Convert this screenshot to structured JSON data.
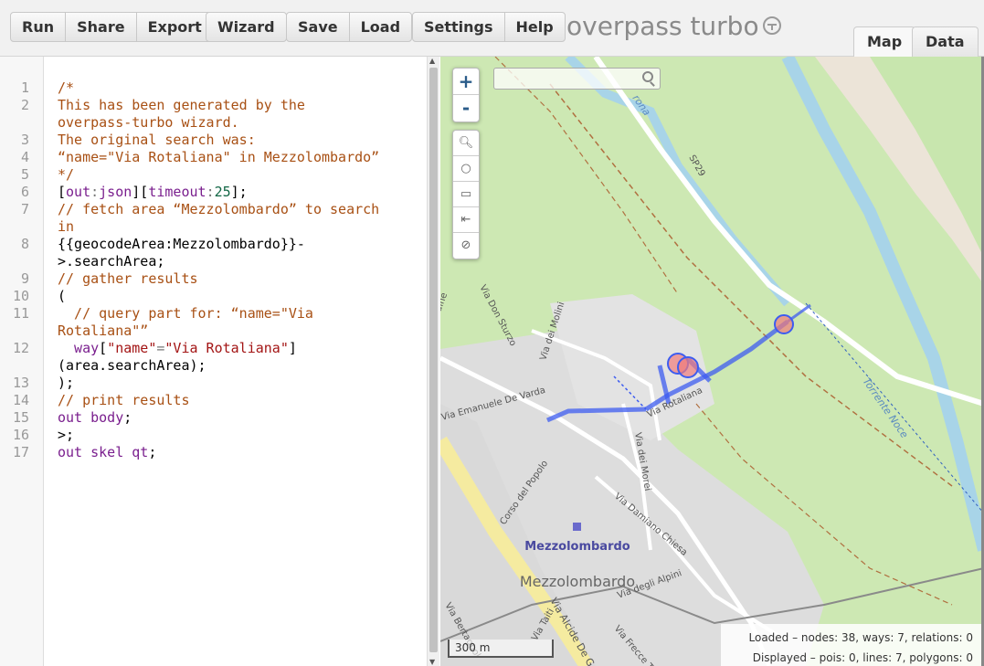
{
  "toolbar": {
    "group1": [
      "Run",
      "Share",
      "Export"
    ],
    "group2": [
      "Wizard"
    ],
    "group3": [
      "Save",
      "Load"
    ],
    "group4": [
      "Settings",
      "Help"
    ],
    "logo": "overpass turbo"
  },
  "tabs": {
    "map": "Map",
    "data": "Data"
  },
  "editor": {
    "line_numbers": [
      "1",
      "2",
      "",
      "3",
      "4",
      "5",
      "6",
      "7",
      "",
      "8",
      "",
      "9",
      "10",
      "11",
      "",
      "12",
      "",
      "13",
      "14",
      "15",
      "16",
      "17"
    ],
    "lines": {
      "l1": "/*",
      "l2a": "This has been generated by the",
      "l2b": "overpass-turbo wizard.",
      "l3": "The original search was:",
      "l4": "“name=\"Via Rotaliana\" in Mezzolombardo”",
      "l5": "*/",
      "l6_a": "[",
      "l6_b": "out",
      "l6_c": ":",
      "l6_d": "json",
      "l6_e": "][",
      "l6_f": "timeout",
      "l6_g": ":",
      "l6_h": "25",
      "l6_i": "];",
      "l7a": "// fetch area “Mezzolombardo” to search",
      "l7b": "in",
      "l8a": "{{geocodeArea:Mezzolombardo}}-",
      "l8b": ">.searchArea;",
      "l9": "// gather results",
      "l10": "(",
      "l11a": "  // query part for: “name=\"Via",
      "l11b": "Rotaliana\"”",
      "l12_kw": "  way",
      "l12_a": "[",
      "l12_str1": "\"name\"",
      "l12_eq": "=",
      "l12_str2": "\"Via Rotaliana\"",
      "l12_b": "]",
      "l12c": "(area.searchArea);",
      "l13": ");",
      "l14": "// print results",
      "l15_kw": "out body",
      "l15_end": ";",
      "l16": ">;",
      "l17_kw": "out skel qt",
      "l17_end": ";"
    }
  },
  "map": {
    "zoom_in": "+",
    "zoom_out": "-",
    "search_placeholder": "",
    "scale": "300 m",
    "labels": {
      "town_bold": "Mezzolombardo",
      "town": "Mezzolombardo",
      "sp29": "SP29",
      "via_rotaliana": "Via Rotaliana",
      "via_don_sturzo": "Via Don Sturzo",
      "via_del_molini": "Via dei Molini",
      "via_emanuele": "Via Emanuele De Varda",
      "via_dei_morei": "Via dei Morei",
      "corso_popolo": "Corso del Popolo",
      "via_damiano": "Via Damiano Chiesa",
      "via_degli_alpini": "Via degli Alpini",
      "via_frecce": "Via Frecce Tricolori",
      "via_alcide": "Via Alcide De G",
      "torrente": "Torrente Noce",
      "rona": "rona",
      "dine": "dine",
      "via_tait": "Via Taiti",
      "via_bertagnol": "Via Bertagnol"
    },
    "stats": {
      "loaded_label": "Loaded",
      "loaded": " – nodes: 38, ways: 7, relations: 0",
      "displayed_label": "Displayed",
      "displayed": " – pois: 0, lines: 7, polygons: 0"
    },
    "colors": {
      "query_line": "#3d5cf0",
      "poi_fill": "#f07c7c",
      "forest": "#cde8b3",
      "river": "#a8d4e8"
    }
  }
}
